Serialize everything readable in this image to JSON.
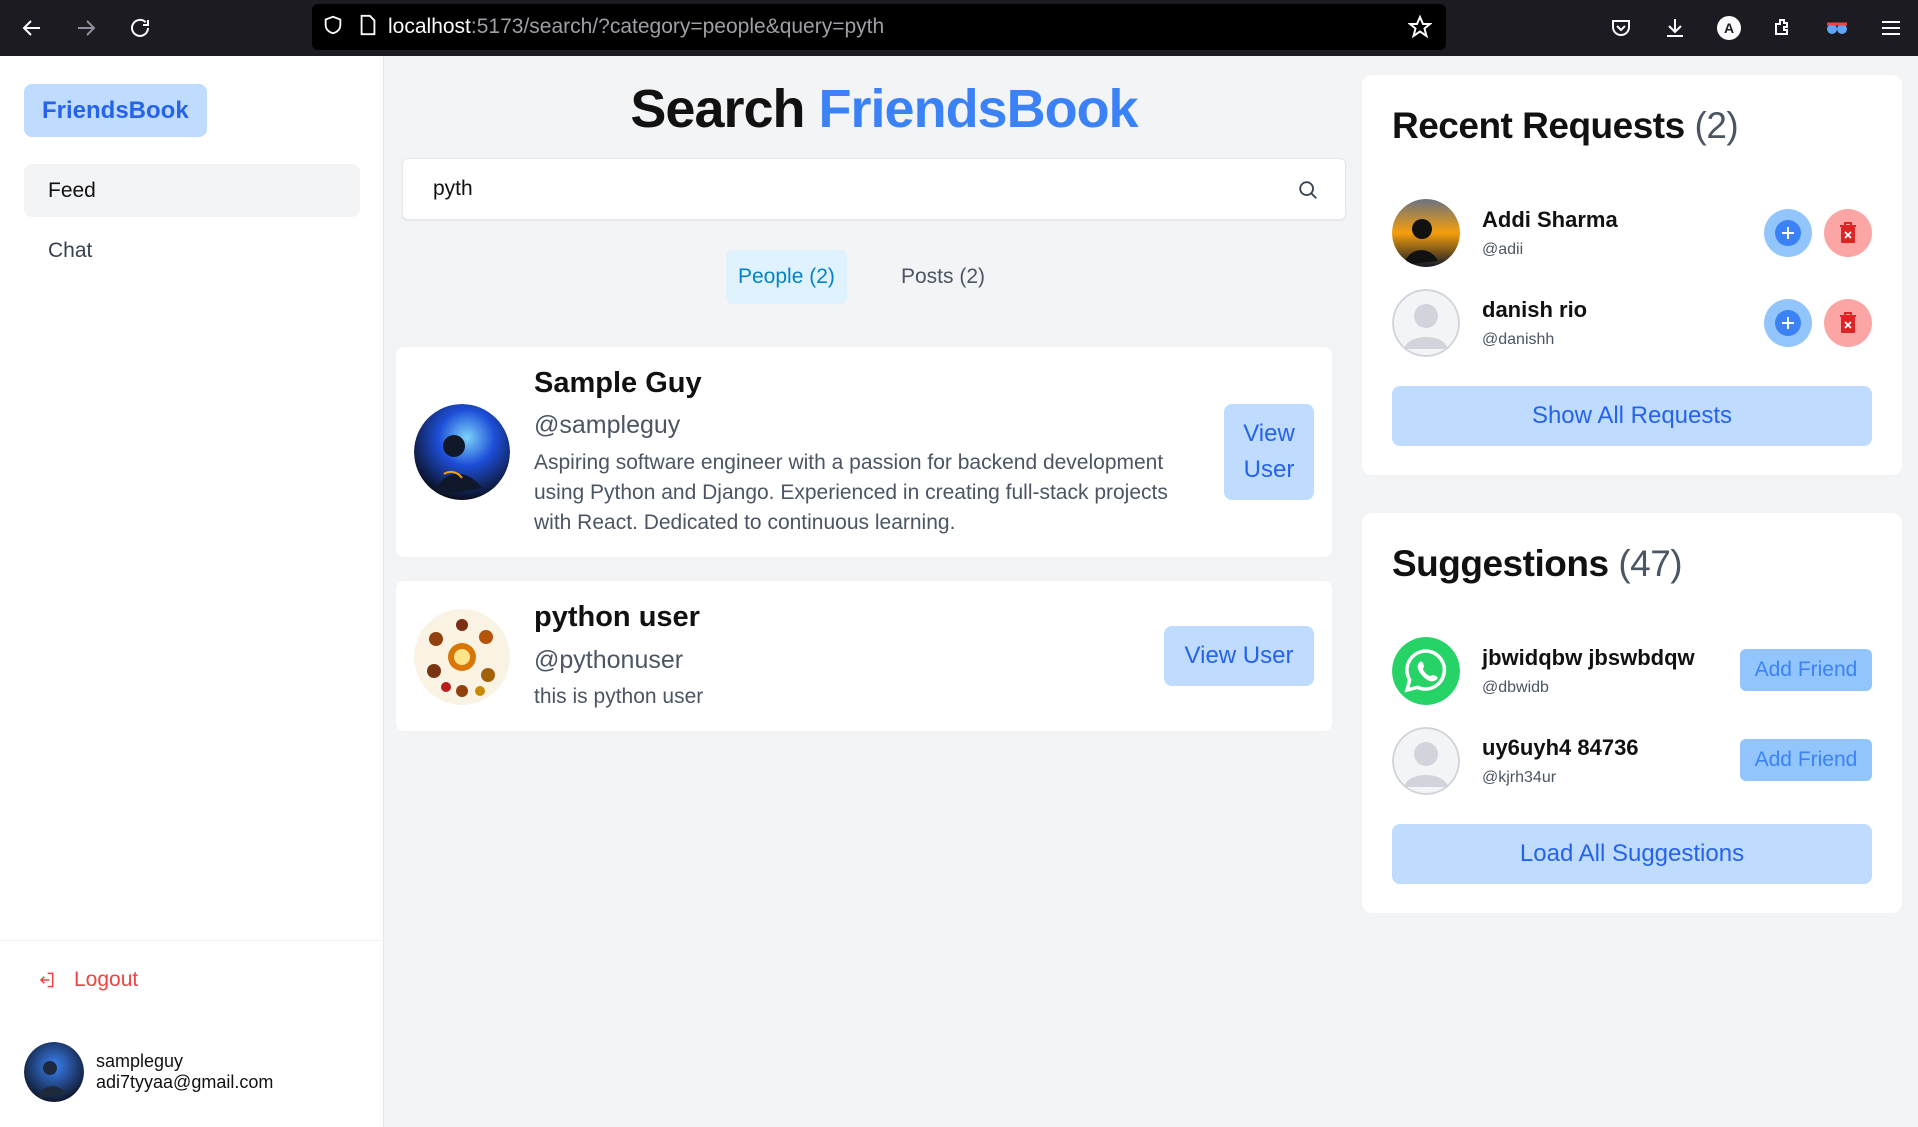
{
  "browser": {
    "url_host": "localhost",
    "url_path": ":5173/search/?category=people&query=pyth",
    "profile_initial": "A"
  },
  "sidebar": {
    "brand": "FriendsBook",
    "items": [
      {
        "label": "Feed",
        "active": true
      },
      {
        "label": "Chat",
        "active": false
      }
    ],
    "logout_label": "Logout",
    "user": {
      "username": "sampleguy",
      "email": "adi7tyyaa@gmail.com"
    }
  },
  "search": {
    "title_part1": "Search",
    "title_part2": "FriendsBook",
    "query": "pyth",
    "tabs": [
      {
        "label": "People (2)",
        "active": true
      },
      {
        "label": "Posts (2)",
        "active": false
      }
    ],
    "results": [
      {
        "name": "Sample Guy",
        "handle": "@sampleguy",
        "bio_lines": [
          "Aspiring software engineer with a passion for backend development",
          "using Python and Django. Experienced in creating full-stack projects",
          "with React. Dedicated to continuous learning."
        ],
        "button_line1": "View",
        "button_line2": "User"
      },
      {
        "name": "python user",
        "handle": "@pythonuser",
        "bio": "this is python user",
        "button": "View User"
      }
    ]
  },
  "requests": {
    "title": "Recent Requests",
    "count": "(2)",
    "items": [
      {
        "name": "Addi Sharma",
        "handle": "@adii"
      },
      {
        "name": "danish rio",
        "handle": "@danishh"
      }
    ],
    "show_all": "Show All Requests"
  },
  "suggestions": {
    "title": "Suggestions",
    "count": "(47)",
    "items": [
      {
        "name": "jbwidqbw jbswbdqw",
        "handle": "@dbwidb",
        "button": "Add Friend"
      },
      {
        "name": "uy6uyh4 84736",
        "handle": "@kjrh34ur",
        "button": "Add Friend"
      }
    ],
    "load_all": "Load All Suggestions"
  },
  "colors": {
    "accent": "#3b82f6",
    "accent_light": "#bfdbfe",
    "danger": "#ef4444",
    "whatsapp": "#25d366"
  }
}
